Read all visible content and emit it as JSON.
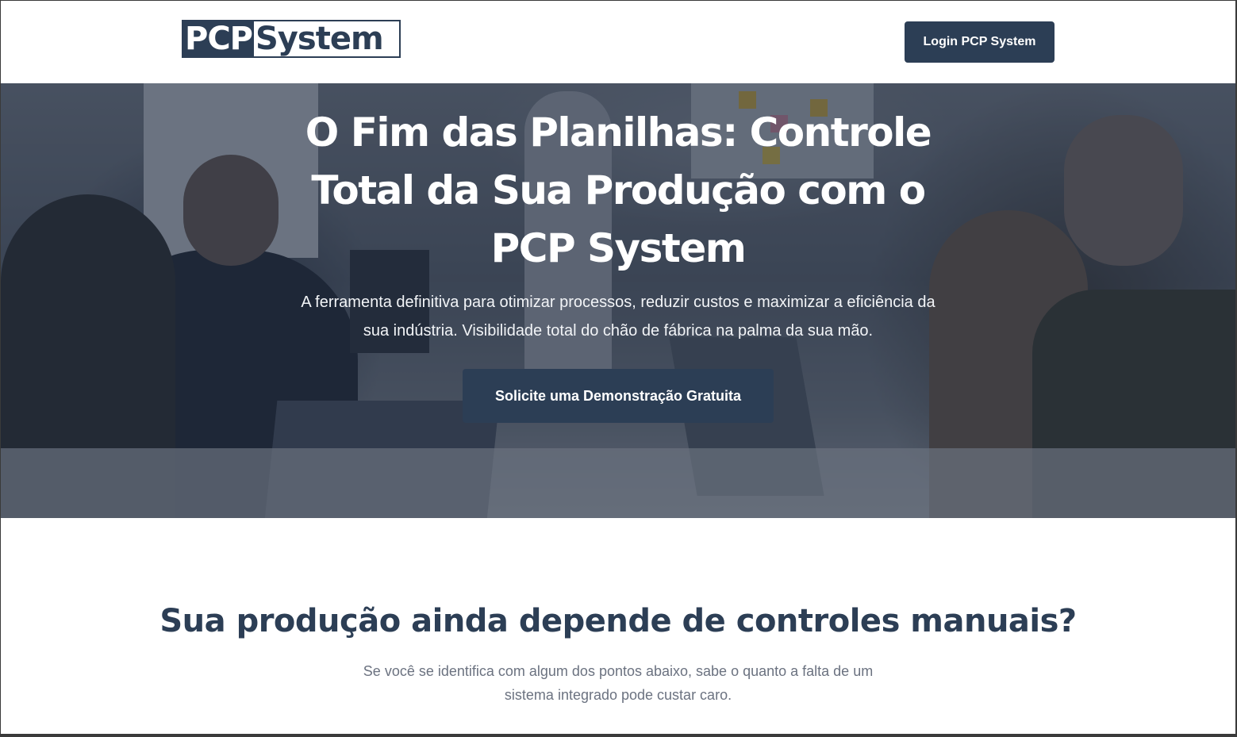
{
  "header": {
    "logo_part1": "PCP",
    "logo_part2": "System",
    "login_label": "Login PCP System"
  },
  "hero": {
    "title": "O Fim das Planilhas: Controle Total da Sua Produção com o PCP System",
    "subtitle": "A ferramenta definitiva para otimizar processos, reduzir custos e maximizar a eficiência da sua indústria. Visibilidade total do chão de fábrica na palma da sua mão.",
    "cta_label": "Solicite uma Demonstração Gratuita"
  },
  "problems": {
    "title": "Sua produção ainda depende de controles manuais?",
    "subtitle": "Se você se identifica com algum dos pontos abaixo, sabe o quanto a falta de um sistema integrado pode custar caro."
  },
  "colors": {
    "brand": "#2c3e55",
    "hero_overlay": "rgba(30,42,62,0.55)",
    "muted_text": "#6b7280"
  }
}
